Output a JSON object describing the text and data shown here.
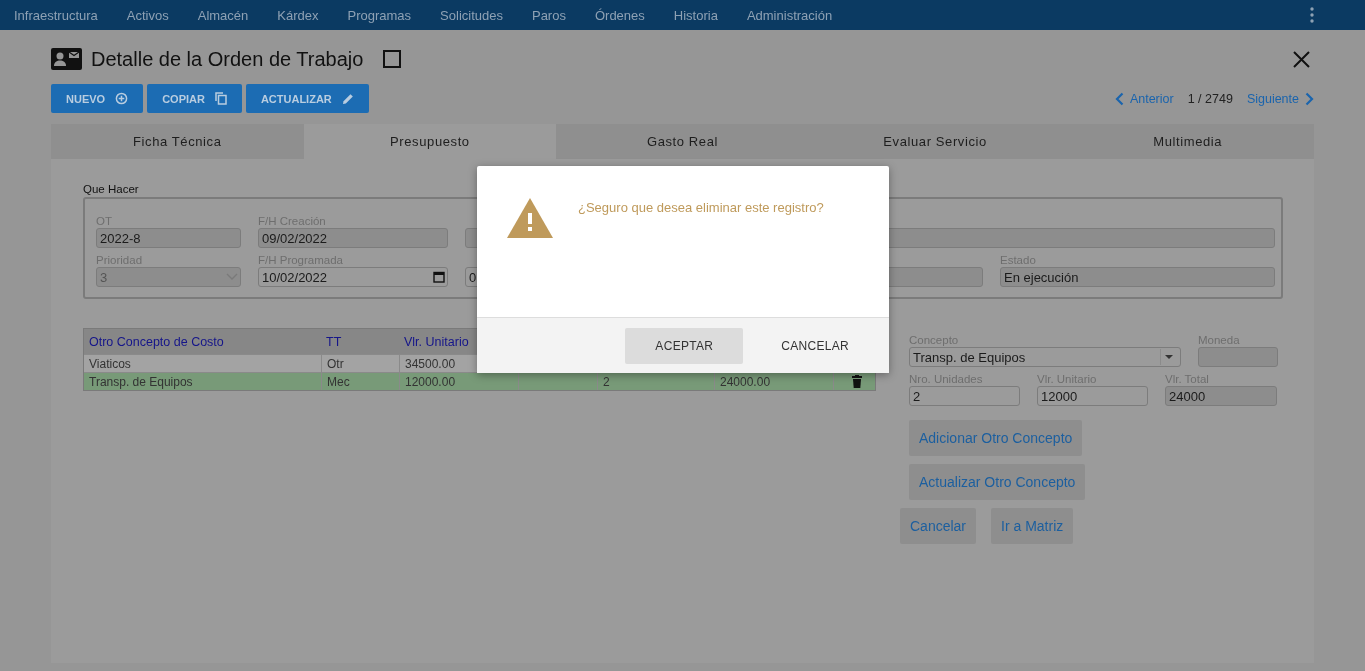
{
  "nav": {
    "items": [
      "Infraestructura",
      "Activos",
      "Almacén",
      "Kárdex",
      "Programas",
      "Solicitudes",
      "Paros",
      "Órdenes",
      "Historia",
      "Administración"
    ]
  },
  "header": {
    "title": "Detalle de la Orden de Trabajo",
    "checked": false
  },
  "toolbar": {
    "buttons": [
      {
        "label": "NUEVO"
      },
      {
        "label": "COPIAR"
      },
      {
        "label": "ACTUALIZAR"
      }
    ]
  },
  "pager": {
    "previous": "Anterior",
    "position": "1 / 2749",
    "next": "Siguiente"
  },
  "tabs": [
    {
      "label": "Ficha Técnica",
      "selected": false
    },
    {
      "label": "Presupuesto",
      "selected": true
    },
    {
      "label": "Gasto Real",
      "selected": false
    },
    {
      "label": "Evaluar Servicio",
      "selected": false
    },
    {
      "label": "Multimedia",
      "selected": false
    }
  ],
  "que_hacer": {
    "legend": "Que Hacer",
    "rows": [
      [
        {
          "kind": "text",
          "label": "OT",
          "value": "2022-8",
          "disabled": true
        },
        {
          "kind": "text",
          "label": "F/H Creación",
          "value": "09/02/2022",
          "disabled": true
        },
        {
          "kind": "text",
          "disabled": true
        }
      ],
      [
        {
          "kind": "select",
          "label": "Prioridad",
          "value": "3",
          "disabled": true
        },
        {
          "kind": "date",
          "label": "F/H Programada",
          "value": "10/02/2022",
          "disabled": false
        },
        {
          "kind": "text",
          "value": "0",
          "disabled": false
        },
        {
          "kind": "text",
          "disabled": true
        },
        {
          "kind": "text",
          "label": "Estado",
          "value": "En ejecución",
          "disabled": true
        }
      ]
    ]
  },
  "table": {
    "columns": [
      "Otro Concepto de Costo",
      "TT",
      "Vlr. Unitario"
    ],
    "rows": [
      {
        "selected": false,
        "cells": {
          "concepto": "Viaticos",
          "tt": "Otr",
          "vlr_unitario": "34500.00"
        }
      },
      {
        "selected": true,
        "delete_icon": true,
        "cells": {
          "concepto": "Transp. de Equipos",
          "tt": "Mec",
          "vlr_unitario": "12000.00",
          "column_5": "2",
          "column_6": "24000.00"
        }
      }
    ]
  },
  "concepto_form": {
    "rows": [
      [
        {
          "kind": "select",
          "label": "Concepto",
          "value": "Transp. de Equipos",
          "disabled": false
        },
        {
          "kind": "text",
          "label": "Moneda",
          "disabled": true
        }
      ],
      [
        {
          "kind": "text",
          "label": "Nro. Unidades",
          "value": "2",
          "disabled": false
        },
        {
          "kind": "text",
          "label": "Vlr. Unitario",
          "value": "12000",
          "disabled": false
        },
        {
          "kind": "text",
          "label": "Vlr. Total",
          "value": "24000",
          "disabled": true
        }
      ]
    ],
    "buttons": [
      "Adicionar Otro Concepto",
      "Actualizar Otro Concepto"
    ],
    "footer_buttons": [
      "Cancelar",
      "Ir a Matriz"
    ]
  },
  "dialog": {
    "message": "¿Seguro que desea eliminar este registro?",
    "buttons": [
      {
        "label": "ACEPTAR",
        "kind": "primary"
      },
      {
        "label": "CANCELAR",
        "kind": "flat"
      }
    ]
  }
}
